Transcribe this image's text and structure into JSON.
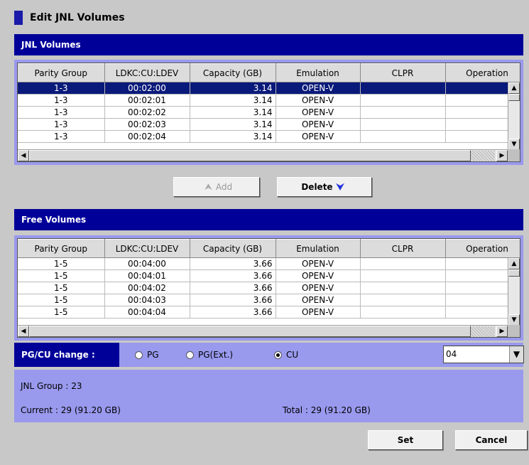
{
  "title": "Edit JNL Volumes",
  "jnl_section": {
    "header": "JNL Volumes"
  },
  "free_section": {
    "header": "Free Volumes"
  },
  "columns": [
    "Parity Group",
    "LDKC:CU:LDEV",
    "Capacity (GB)",
    "Emulation",
    "CLPR",
    "Operation"
  ],
  "jnl_rows": [
    [
      "1-3",
      "00:02:00",
      "3.14",
      "OPEN-V",
      "",
      ""
    ],
    [
      "1-3",
      "00:02:01",
      "3.14",
      "OPEN-V",
      "",
      ""
    ],
    [
      "1-3",
      "00:02:02",
      "3.14",
      "OPEN-V",
      "",
      ""
    ],
    [
      "1-3",
      "00:02:03",
      "3.14",
      "OPEN-V",
      "",
      ""
    ],
    [
      "1-3",
      "00:02:04",
      "3.14",
      "OPEN-V",
      "",
      ""
    ]
  ],
  "free_rows": [
    [
      "1-5",
      "00:04:00",
      "3.66",
      "OPEN-V",
      "",
      ""
    ],
    [
      "1-5",
      "00:04:01",
      "3.66",
      "OPEN-V",
      "",
      ""
    ],
    [
      "1-5",
      "00:04:02",
      "3.66",
      "OPEN-V",
      "",
      ""
    ],
    [
      "1-5",
      "00:04:03",
      "3.66",
      "OPEN-V",
      "",
      ""
    ],
    [
      "1-5",
      "00:04:04",
      "3.66",
      "OPEN-V",
      "",
      ""
    ]
  ],
  "buttons": {
    "add": "Add",
    "delete": "Delete",
    "set": "Set",
    "cancel": "Cancel"
  },
  "pgcu": {
    "label": "PG/CU change :",
    "options": [
      "PG",
      "PG(Ext.)",
      "CU"
    ],
    "selected": "CU",
    "combo_value": "04"
  },
  "info": {
    "jnl_group": "JNL Group : 23",
    "current": "Current : 29 (91.20 GB)",
    "total": "Total : 29 (91.20 GB)"
  },
  "colors": {
    "header_bg": "#000099",
    "panel_bg": "#9999ee",
    "selected_row": "#0a1a7a",
    "window_bg": "#c8c8c8"
  },
  "icons": {
    "add": "double-chevron-up-icon",
    "delete": "double-chevron-down-icon"
  }
}
